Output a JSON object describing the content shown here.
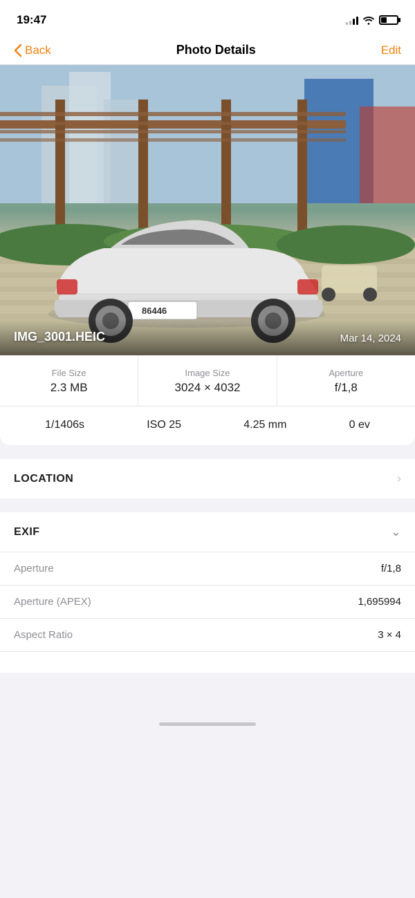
{
  "statusBar": {
    "time": "19:47"
  },
  "navBar": {
    "backLabel": "Back",
    "title": "Photo Details",
    "editLabel": "Edit"
  },
  "photo": {
    "filename": "IMG_3001.HEIC",
    "date": "Mar 14, 2024"
  },
  "infoCard": {
    "fileSize": {
      "label": "File Size",
      "value": "2.3 MB"
    },
    "imageSize": {
      "label": "Image Size",
      "value": "3024 × 4032"
    },
    "aperture": {
      "label": "Aperture",
      "value": "f/1,8"
    },
    "specs": [
      "1/1406s",
      "ISO 25",
      "4.25 mm",
      "0 ev"
    ]
  },
  "sections": {
    "location": "LOCATION",
    "exif": "EXIF"
  },
  "exifRows": [
    {
      "key": "Aperture",
      "value": "f/1,8"
    },
    {
      "key": "Aperture (APEX)",
      "value": "1,695994"
    },
    {
      "key": "Aspect Ratio",
      "value": "3 × 4"
    }
  ],
  "exifPartial": {
    "key": "",
    "value": ""
  }
}
